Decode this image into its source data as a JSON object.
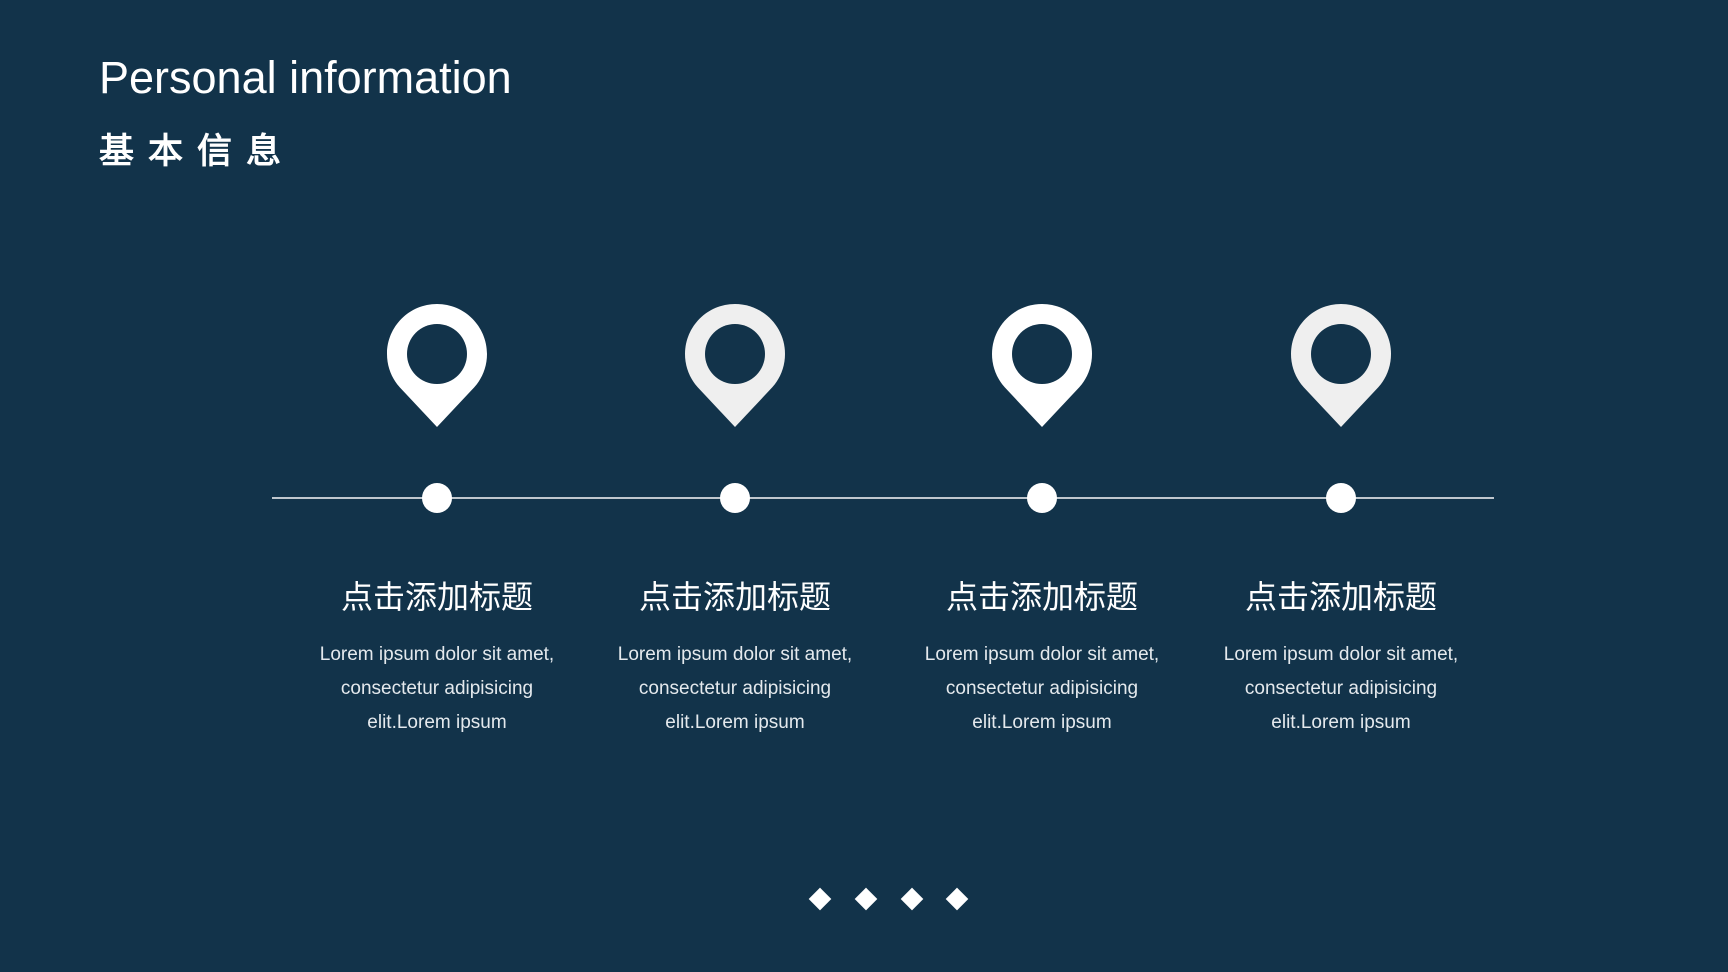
{
  "header": {
    "title": "Personal information",
    "subtitle": "基本信息"
  },
  "milestones": [
    {
      "title": "点击添加标题",
      "lines": [
        "Lorem ipsum dolor sit amet,",
        "consectetur adipisicing",
        "elit.Lorem ipsum"
      ],
      "icon": "location-pin-icon"
    },
    {
      "title": "点击添加标题",
      "lines": [
        "Lorem ipsum dolor sit amet,",
        "consectetur adipisicing",
        "elit.Lorem ipsum"
      ],
      "icon": "location-pin-icon"
    },
    {
      "title": "点击添加标题",
      "lines": [
        "Lorem ipsum dolor sit amet,",
        "consectetur adipisicing",
        "elit.Lorem ipsum"
      ],
      "icon": "location-pin-icon"
    },
    {
      "title": "点击添加标题",
      "lines": [
        "Lorem ipsum dolor sit amet,",
        "consectetur adipisicing",
        "elit.Lorem ipsum"
      ],
      "icon": "location-pin-icon"
    }
  ],
  "pager": {
    "count": 4,
    "icon": "diamond-icon"
  },
  "colors": {
    "background": "#12334A",
    "foreground": "#FFFFFF",
    "line": "#BFC7CE"
  }
}
